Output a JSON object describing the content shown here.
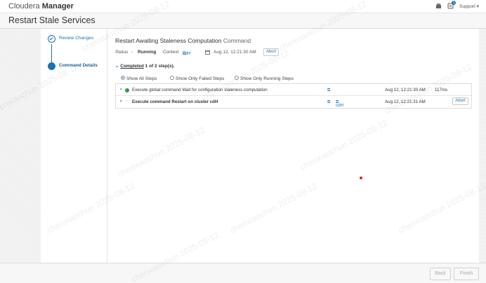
{
  "header": {
    "brand_light": "Cloudera",
    "brand_bold": "Manager",
    "notification_count": "1",
    "support_label": "Support"
  },
  "page": {
    "title": "Restart Stale Services"
  },
  "wizard": {
    "steps": [
      {
        "label": "Review Changes",
        "state": "done"
      },
      {
        "label": "Command Details",
        "state": "active"
      }
    ]
  },
  "command": {
    "title": "Restart Awaiting Staleness Computation",
    "title_suffix": "Command",
    "status_label": "Status",
    "status_value": "Running",
    "context_label": "Context",
    "context_value": "cdH",
    "timestamp": "Aug 12, 12:21:30 AM",
    "abort_label": "Abort",
    "completed_prefix": "Completed",
    "completed_count": "1 of 2 step(s)."
  },
  "filters": {
    "options": [
      "Show All Steps",
      "Show Only Failed Steps",
      "Show Only Running Steps"
    ],
    "selected": "Show All Steps"
  },
  "steps": [
    {
      "description": "Execute global command Wait for configuration staleness computation",
      "status": "success",
      "timestamp": "Aug 12, 12:21:30 AM",
      "duration": "117ms",
      "context": "",
      "action": ""
    },
    {
      "description": "Execute command Restart on cluster cdH",
      "status": "running",
      "timestamp": "Aug 12, 12:21:31 AM",
      "duration": "",
      "context": "cdH",
      "action": "Abort"
    }
  ],
  "footer": {
    "back_label": "Back",
    "finish_label": "Finish"
  },
  "watermark": "chenxiaochun 2025-08-12",
  "colors": {
    "accent": "#1a73b5",
    "success": "#2e9a47",
    "pointer": "#e02020"
  }
}
